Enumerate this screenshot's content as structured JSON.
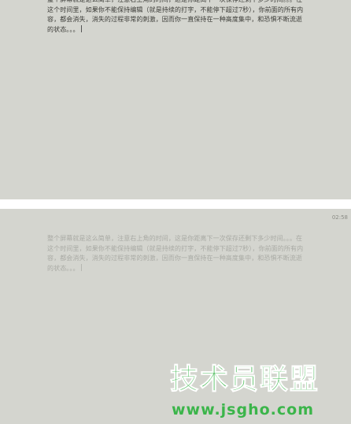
{
  "editor_top": {
    "text": "整个屏幕就是这么简单，注意右上角的时间，这是你距离下一次保存还剩下多少时间。。。在这个时间里，如果你不能保持编辑（就是持续的打字，不能停下超过7秒），你前面的所有内容，都会消失，消失的过程非常的刺激，因而你一直保持在一种高度集中，和恐惧不断流逝的状态。。。"
  },
  "editor_bottom": {
    "text": "整个屏幕就是这么简单，注意右上角的时间，这是你距离下一次保存还剩下多少时间。。。在这个时间里，如果你不能保持编辑（就是持续的打字，不能停下超过7秒），你前面的所有内容，都会消失，消失的过程非常的刺激，因而你一直保持在一种高度集中，和恐惧不断流逝的状态。。。",
    "timer": "02:58"
  },
  "watermark": {
    "text": "技术员联盟",
    "url": "www.jsgho.com"
  },
  "colors": {
    "panel_bg": "#d4d5cf",
    "text_dark": "#3a3a36",
    "text_faded": "#a9aaa4",
    "watermark_green": "#3bb54a"
  }
}
